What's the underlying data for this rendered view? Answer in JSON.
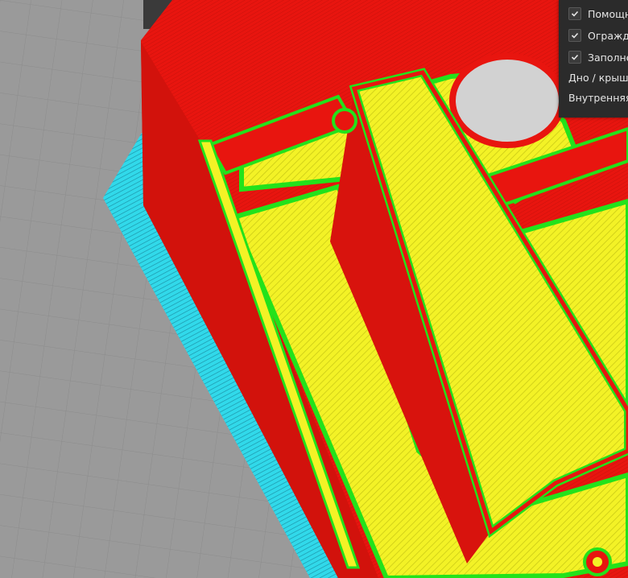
{
  "viewport": {
    "name": "3d-layer-preview",
    "colors": {
      "build_plate": "#9a9a9a",
      "grid_line": "#8e8e8e",
      "shell": "#e8150f",
      "shell_dark": "#b80e0a",
      "perimeter": "#23e21b",
      "infill": "#f3f226",
      "skirt": "#31d9ea",
      "skirt_dark": "#1c8fa3",
      "hole": "#d2d2d2"
    }
  },
  "legend": {
    "items": [
      {
        "label": "Помощн",
        "checked": true
      },
      {
        "label": "Огражде",
        "checked": true
      },
      {
        "label": "Заполне",
        "checked": true
      }
    ],
    "sections": [
      {
        "label": "Дно / крышк"
      },
      {
        "label": "Внутренняя"
      }
    ]
  }
}
